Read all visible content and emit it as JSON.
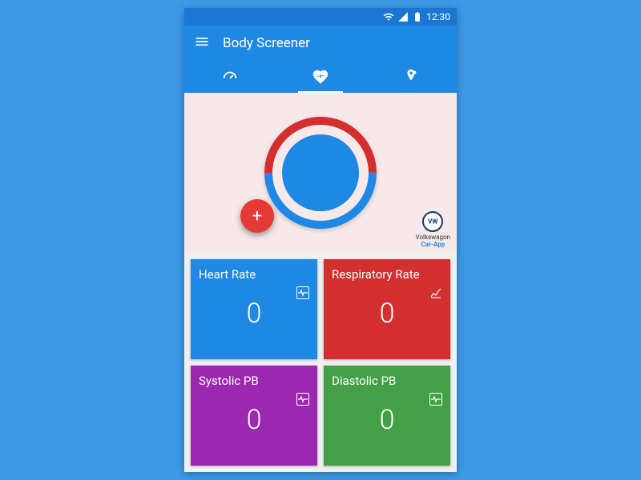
{
  "status": {
    "time": "12:30"
  },
  "app": {
    "title": "Body Screener"
  },
  "sponsor": {
    "name": "Volkswagon",
    "sub": "Car-App"
  },
  "cards": {
    "heart": {
      "label": "Heart Rate",
      "value": "0"
    },
    "resp": {
      "label": "Respiratory Rate",
      "value": "0"
    },
    "sys": {
      "label": "Systolic PB",
      "value": "0"
    },
    "dia": {
      "label": "Diastolic PB",
      "value": "0"
    }
  }
}
